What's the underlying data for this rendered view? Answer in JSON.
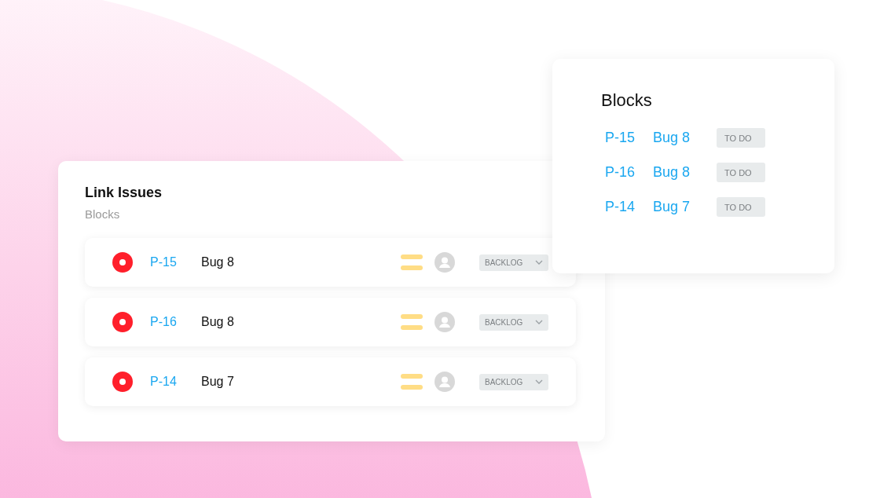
{
  "link_issues": {
    "title": "Link Issues",
    "subtitle": "Blocks",
    "rows": [
      {
        "key": "P-15",
        "summary": "Bug 8",
        "status": "BACKLOG"
      },
      {
        "key": "P-16",
        "summary": "Bug 8",
        "status": "BACKLOG"
      },
      {
        "key": "P-14",
        "summary": "Bug 7",
        "status": "BACKLOG"
      }
    ]
  },
  "blocks": {
    "title": "Blocks",
    "rows": [
      {
        "key": "P-15",
        "summary": "Bug 8",
        "status": "TO DO"
      },
      {
        "key": "P-16",
        "summary": "Bug 8",
        "status": "TO DO"
      },
      {
        "key": "P-14",
        "summary": "Bug 7",
        "status": "TO DO"
      }
    ]
  }
}
